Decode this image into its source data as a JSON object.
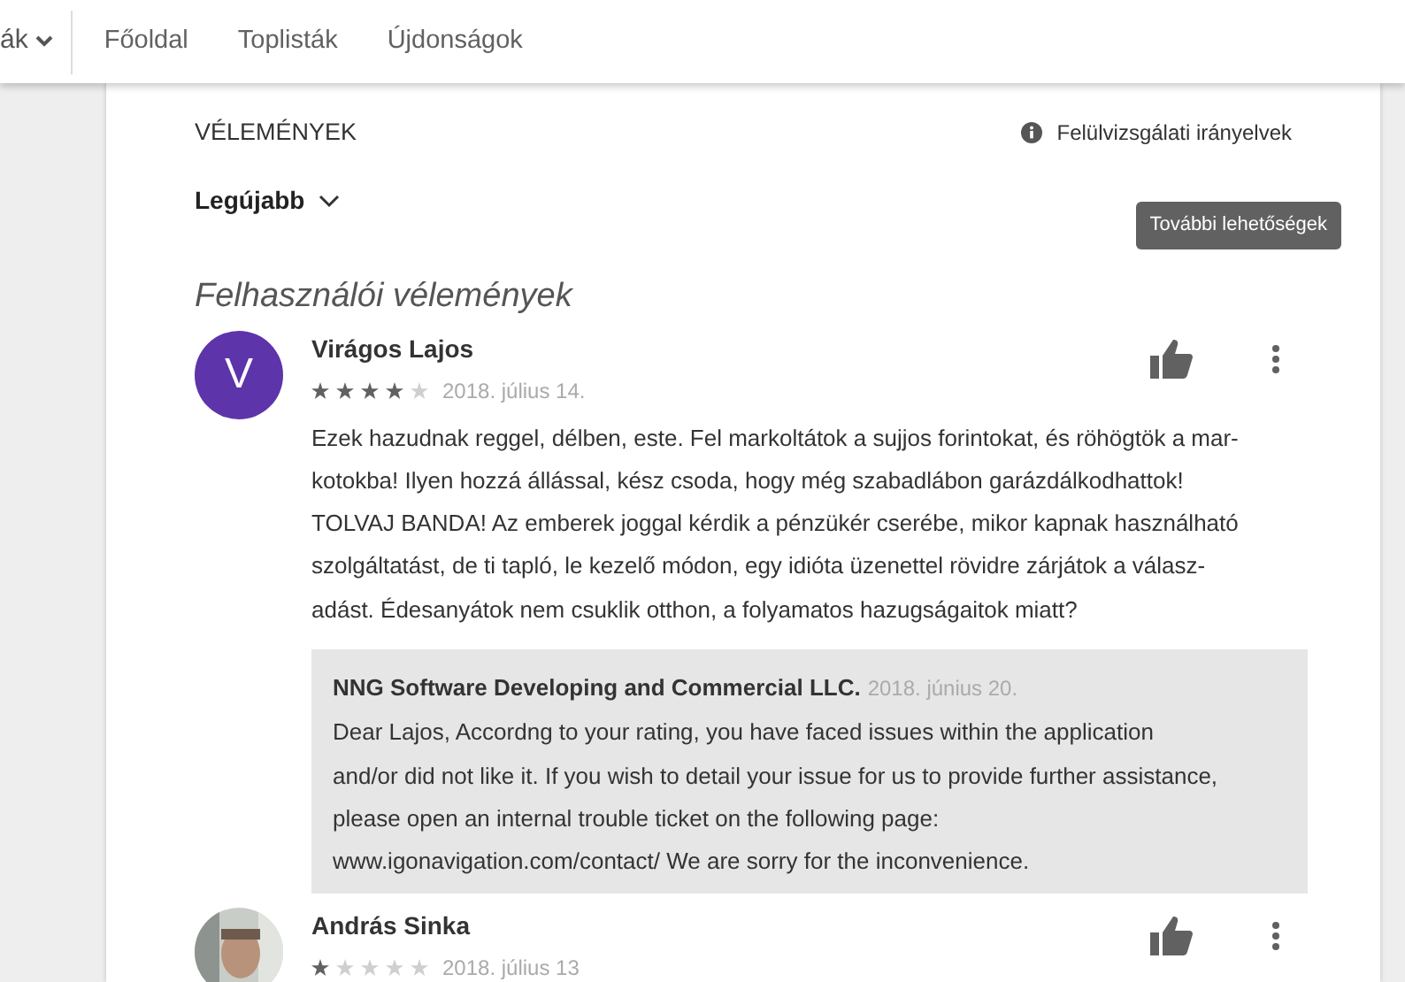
{
  "header": {
    "menu_cut": "ák",
    "nav": [
      {
        "label": "Főoldal"
      },
      {
        "label": "Toplisták"
      },
      {
        "label": "Újdonságok"
      }
    ]
  },
  "section_title": "VÉLEMÉNYEK",
  "guidelines_link": "Felülvizsgálati irányelvek",
  "sort": {
    "label": "Legújabb"
  },
  "tooltip": "További lehetőségek",
  "reviews_heading": "Felhasználói vélemények",
  "reviews": [
    {
      "author": "Virágos Lajos",
      "avatar": {
        "kind": "letter",
        "letter": "V"
      },
      "stars": 4,
      "date": "2018. július 14.",
      "body_lines": [
        "Ezek hazudnak reggel, délben, este. Fel markoltátok a sujjos forintokat, és röhögtök a mar-",
        "kotokba! Ilyen hozzá állással, kész csoda, hogy még szabadlábon garázdálkodhattok!",
        "TOLVAJ BANDA! Az emberek joggal kérdik a pénzükér cserébe, mikor kapnak használható",
        "szolgáltatást, de ti tapló, le kezelő módon, egy idióta üzenettel rövidre zárjátok a válasz-",
        "adást. Édesanyátok nem csuklik otthon, a folyamatos hazugságaitok miatt?"
      ],
      "reply": {
        "author": "NNG Software Developing and Commercial LLC.",
        "date": "2018. június 20.",
        "body_lines": [
          "Dear Lajos, Accordng to your rating, you have faced issues within the application",
          "and/or did not like it. If you wish to detail your issue for us to provide further assistance,",
          "please open an internal trouble ticket on the following page:",
          "www.igonavigation.com/contact/ We are sorry for the inconvenience."
        ]
      }
    },
    {
      "author": "András Sinka",
      "stars": 1,
      "date": "2018. július 13"
    }
  ]
}
